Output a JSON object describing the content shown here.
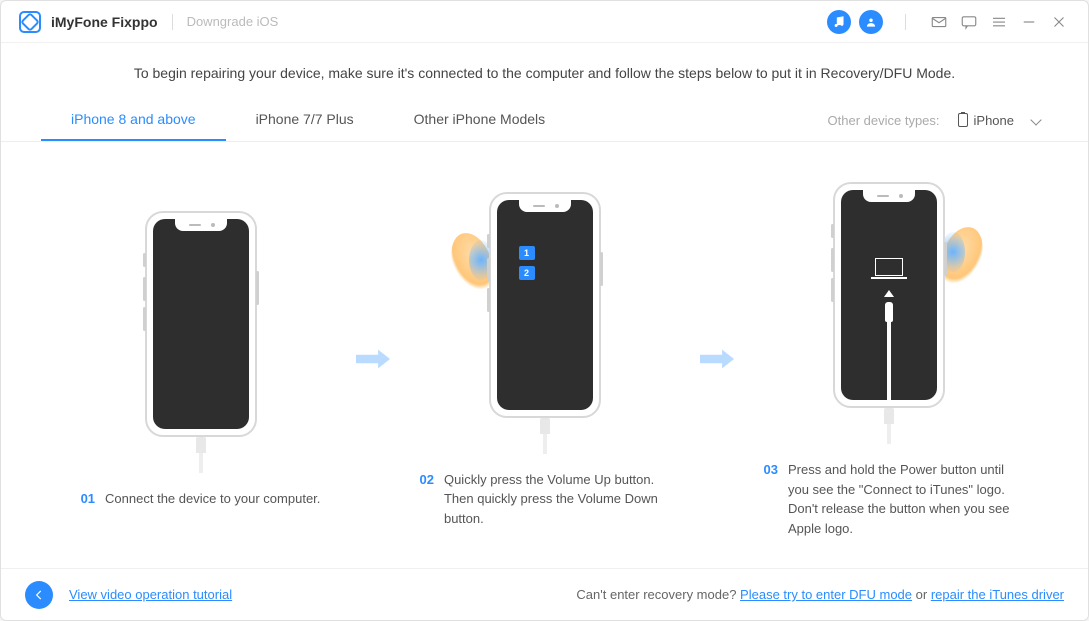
{
  "header": {
    "app_name": "iMyFone Fixppo",
    "breadcrumb": "Downgrade iOS"
  },
  "intro": "To begin repairing your device, make sure it's connected to the computer and follow the steps below to put it in Recovery/DFU Mode.",
  "tabs": {
    "items": [
      {
        "label": "iPhone 8 and above",
        "active": true
      },
      {
        "label": "iPhone 7/7 Plus",
        "active": false
      },
      {
        "label": "Other iPhone Models",
        "active": false
      }
    ],
    "other_types_label": "Other device types:",
    "selected_device": "iPhone"
  },
  "steps": [
    {
      "num": "01",
      "text": "Connect the device to your computer."
    },
    {
      "num": "02",
      "text": "Quickly press the Volume Up button. Then quickly press the Volume Down button.",
      "badge1": "1",
      "badge2": "2"
    },
    {
      "num": "03",
      "text": "Press and hold the Power button until you see the \"Connect to iTunes\" logo. Don't release the button when you see Apple logo."
    }
  ],
  "footer": {
    "tutorial_link": "View video operation tutorial",
    "help_prefix": "Can't enter recovery mode? ",
    "dfu_link": "Please try to enter DFU mode",
    "or_text": " or ",
    "repair_link": "repair the iTunes driver"
  }
}
